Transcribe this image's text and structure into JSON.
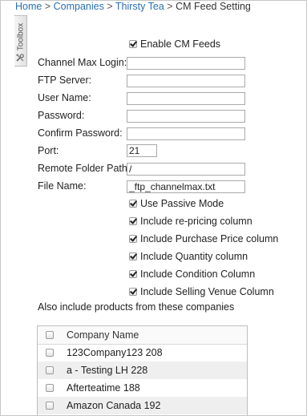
{
  "breadcrumb": {
    "home": "Home",
    "companies": "Companies",
    "company": "Thirsty Tea",
    "current": "CM Feed Setting",
    "separator": ">"
  },
  "toolbox": {
    "label": "Toolbox"
  },
  "form": {
    "enable_cm_feeds": {
      "label": "Enable CM Feeds",
      "checked": true
    },
    "channel_max_login": {
      "label": "Channel Max Login:",
      "value": ""
    },
    "ftp_server": {
      "label": "FTP Server:",
      "value": ""
    },
    "user_name": {
      "label": "User Name:",
      "value": ""
    },
    "password": {
      "label": "Password:",
      "value": ""
    },
    "confirm_password": {
      "label": "Confirm Password:",
      "value": ""
    },
    "port": {
      "label": "Port:",
      "value": "21"
    },
    "remote_folder_path": {
      "label": "Remote Folder Path:",
      "value": "/"
    },
    "file_name": {
      "label": "File Name:",
      "value": "_ftp_channelmax.txt"
    },
    "options": [
      {
        "label": "Use Passive Mode",
        "checked": true
      },
      {
        "label": "Include re-pricing column",
        "checked": true
      },
      {
        "label": "Include Purchase Price column",
        "checked": true
      },
      {
        "label": "Include Quantity column",
        "checked": true
      },
      {
        "label": "Include Condition Column",
        "checked": true
      },
      {
        "label": "Include Selling Venue Column",
        "checked": true
      }
    ]
  },
  "also_include": "Also include products from these companies",
  "companies_table": {
    "header": "Company Name",
    "rows": [
      "123Company123 208",
      "a - Testing LH 228",
      "Afterteatime 188",
      "Amazon Canada 192"
    ]
  }
}
